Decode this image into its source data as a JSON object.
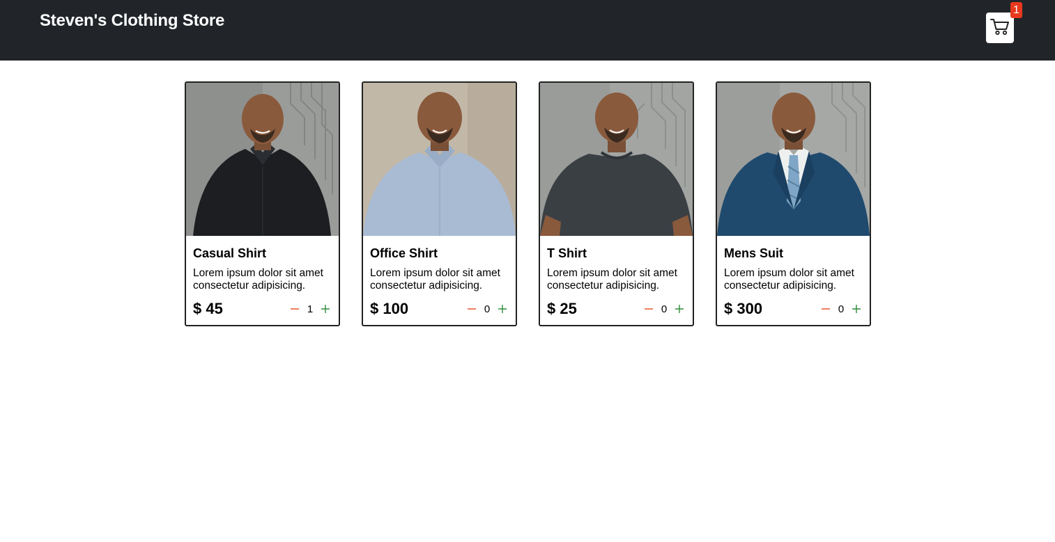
{
  "header": {
    "brand": "Steven's Clothing Store",
    "cart_count": "1",
    "cart_icon": "shopping-cart-icon"
  },
  "colors": {
    "navbar_bg": "#212529",
    "badge": "#e8391e",
    "minus": "#e8572e",
    "plus": "#2e8b3a"
  },
  "products": [
    {
      "name": "Casual Shirt",
      "description": "Lorem ipsum dolor sit amet consectetur adipisicing.",
      "price": "$ 45",
      "quantity": "1",
      "image": "man-black-casual-shirt-photo"
    },
    {
      "name": "Office Shirt",
      "description": "Lorem ipsum dolor sit amet consectetur adipisicing.",
      "price": "$ 100",
      "quantity": "0",
      "image": "man-light-blue-office-shirt-photo"
    },
    {
      "name": "T Shirt",
      "description": "Lorem ipsum dolor sit amet consectetur adipisicing.",
      "price": "$ 25",
      "quantity": "0",
      "image": "man-dark-grey-tshirt-photo"
    },
    {
      "name": "Mens Suit",
      "description": "Lorem ipsum dolor sit amet consectetur adipisicing.",
      "price": "$ 300",
      "quantity": "0",
      "image": "man-blue-suit-photo"
    }
  ]
}
